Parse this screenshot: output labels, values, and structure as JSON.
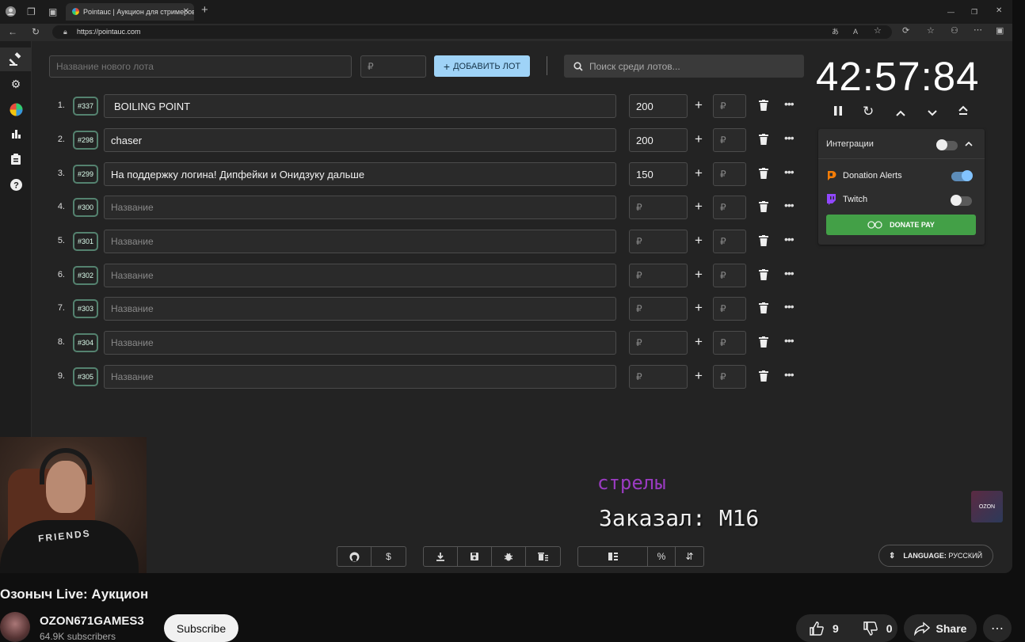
{
  "browser": {
    "tab_title": "Pointauc | Аукцион для стримеров",
    "url": "https://pointauc.com"
  },
  "top": {
    "new_lot_placeholder": "Название нового лота",
    "amount_placeholder": "₽",
    "add_lot_label": "ДОБАВИТЬ ЛОТ",
    "search_placeholder": "Поиск среди лотов..."
  },
  "lots": [
    {
      "num": "1.",
      "id": "#337",
      "name": "BOILING POINT",
      "amount": "200",
      "placeholder": "Название",
      "currency": "₽"
    },
    {
      "num": "2.",
      "id": "#298",
      "name": "chaser",
      "amount": "200",
      "placeholder": "Название",
      "currency": "₽"
    },
    {
      "num": "3.",
      "id": "#299",
      "name": "На поддержку логина! Дипфейки и Онидзуку дальше",
      "amount": "150",
      "placeholder": "Название",
      "currency": "₽"
    },
    {
      "num": "4.",
      "id": "#300",
      "name": "",
      "amount": "",
      "placeholder": "Название",
      "currency": "₽"
    },
    {
      "num": "5.",
      "id": "#301",
      "name": "",
      "amount": "",
      "placeholder": "Название",
      "currency": "₽"
    },
    {
      "num": "6.",
      "id": "#302",
      "name": "",
      "amount": "",
      "placeholder": "Название",
      "currency": "₽"
    },
    {
      "num": "7.",
      "id": "#303",
      "name": "",
      "amount": "",
      "placeholder": "Название",
      "currency": "₽"
    },
    {
      "num": "8.",
      "id": "#304",
      "name": "",
      "amount": "",
      "placeholder": "Название",
      "currency": "₽"
    },
    {
      "num": "9.",
      "id": "#305",
      "name": "",
      "amount": "",
      "placeholder": "Название",
      "currency": "₽"
    }
  ],
  "timer": {
    "value": "42:57:84"
  },
  "integrations": {
    "title": "Интеграции",
    "donation_alerts": "Donation Alerts",
    "twitch": "Twitch",
    "donate_pay": "DONATE PAY"
  },
  "footer": {
    "language_label": "LANGUAGE:",
    "language_value": "РУССКИЙ"
  },
  "stream_overlay": {
    "purple_text": "стрелы",
    "order_text": "Заказал: М16",
    "shirt_text": "FRIENDS"
  },
  "youtube": {
    "video_title": "Озоныч Live: Аукцион",
    "channel": "OZON671GAMES3",
    "subscribers": "64.9K subscribers",
    "subscribe_label": "Subscribe",
    "likes": "9",
    "dislikes": "0",
    "share_label": "Share"
  },
  "colors": {
    "accent_button": "#9fd3f7",
    "donate_green": "#43a047",
    "lot_id_border": "#54826f",
    "overlay_purple": "#9b3bc2"
  }
}
